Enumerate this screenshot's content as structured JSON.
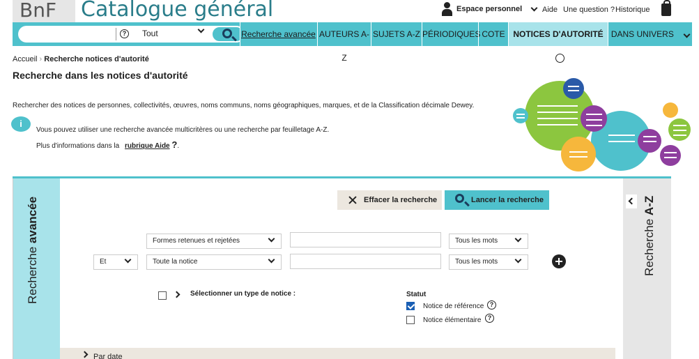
{
  "header": {
    "logo": "BnF",
    "title": "Catalogue général",
    "espace": "Espace personnel",
    "aide": "Aide",
    "question": "Une question ?",
    "historique": "Historique"
  },
  "nav": {
    "search_scope": "Tout",
    "search_placeholder": "",
    "items": [
      "Recherche avancée",
      "AUTEURS A-Z",
      "SUJETS A-Z",
      "PÉRIODIQUES",
      "COTE",
      "NOTICES D'AUTORITÉ",
      "DANS UNIVERS"
    ]
  },
  "breadcrumb": {
    "home": "Accueil",
    "current": "Recherche notices d'autorité"
  },
  "page": {
    "title": "Recherche dans les notices d'autorité",
    "intro": "Rechercher des notices de personnes, collectivités, œuvres, noms communs, noms géographiques, marques, et de la Classification décimale Dewey.",
    "info_line1": "Vous pouvez utiliser une recherche avancée multicritères ou une recherche par feuilletage A-Z.",
    "info_line2": "Plus d'informations dans la",
    "info_link": "rubrique Aide",
    "info_end": "."
  },
  "panel": {
    "side_left_a": "Recherche ",
    "side_left_b": "avancée",
    "side_right_a": "Recherche ",
    "side_right_b": "A-Z",
    "clear": "Effacer la recherche",
    "launch": "Lancer la recherche",
    "row1_field": "Formes retenues et rejetées",
    "row1_mode": "Tous les mots",
    "row2_op": "Et",
    "row2_field": "Toute la notice",
    "row2_mode": "Tous les mots",
    "select_type": "Sélectionner un type de notice :",
    "statut": "Statut",
    "ref": "Notice de référence",
    "elem": "Notice élémentaire",
    "par_date": "Par date"
  },
  "colors": {
    "accent": "#4fc1cc",
    "accent_light": "#a8e3ea",
    "beige": "#ece7df"
  }
}
